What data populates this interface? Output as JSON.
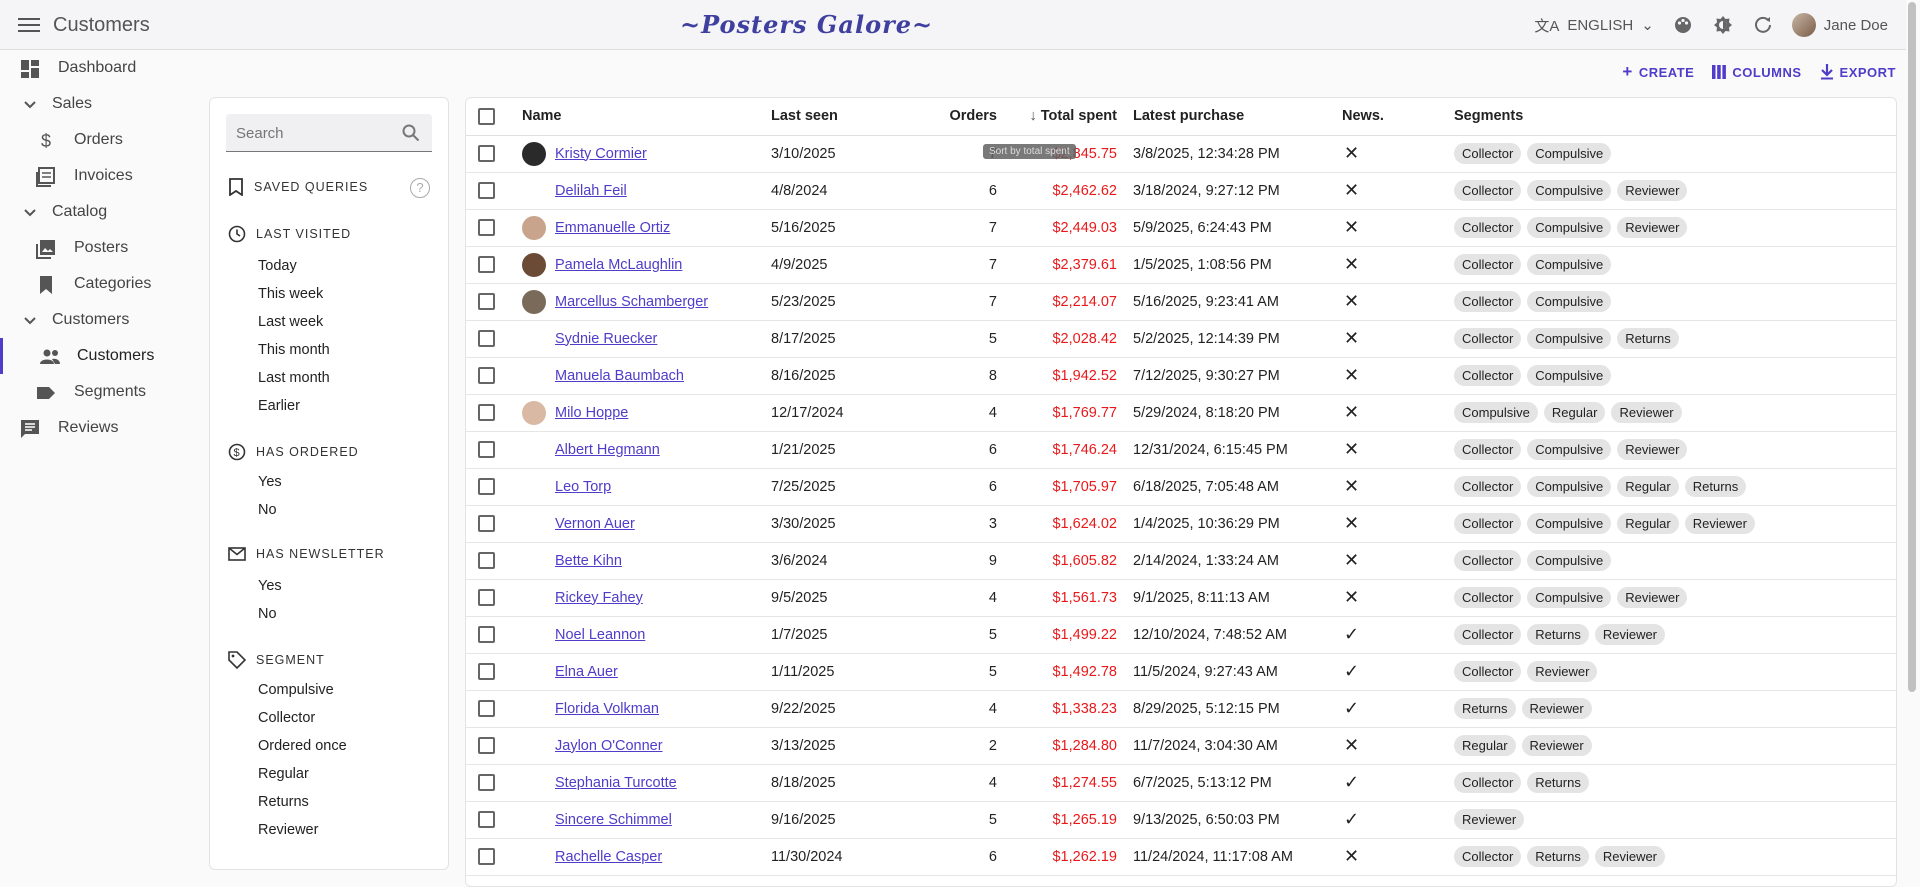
{
  "app": {
    "title": "Customers",
    "brand": "~Posters Galore~",
    "language": "ENGLISH",
    "user": "Jane Doe"
  },
  "sidebar": {
    "items": [
      {
        "label": "Dashboard",
        "icon": "dashboard-icon",
        "kind": "top"
      },
      {
        "label": "Sales",
        "icon": "chevron-down-icon",
        "kind": "group"
      },
      {
        "label": "Orders",
        "icon": "dollar-icon",
        "kind": "sub"
      },
      {
        "label": "Invoices",
        "icon": "invoice-icon",
        "kind": "sub"
      },
      {
        "label": "Catalog",
        "icon": "chevron-down-icon",
        "kind": "group"
      },
      {
        "label": "Posters",
        "icon": "image-icon",
        "kind": "sub"
      },
      {
        "label": "Categories",
        "icon": "bookmark-icon",
        "kind": "sub"
      },
      {
        "label": "Customers",
        "icon": "chevron-down-icon",
        "kind": "group"
      },
      {
        "label": "Customers",
        "icon": "people-icon",
        "kind": "sub",
        "active": true
      },
      {
        "label": "Segments",
        "icon": "label-icon",
        "kind": "sub"
      },
      {
        "label": "Reviews",
        "icon": "comment-icon",
        "kind": "top"
      }
    ]
  },
  "filters": {
    "search_placeholder": "Search",
    "saved_queries": "SAVED QUERIES",
    "last_visited": {
      "title": "LAST VISITED",
      "options": [
        "Today",
        "This week",
        "Last week",
        "This month",
        "Last month",
        "Earlier"
      ]
    },
    "has_ordered": {
      "title": "HAS ORDERED",
      "options": [
        "Yes",
        "No"
      ]
    },
    "has_newsletter": {
      "title": "HAS NEWSLETTER",
      "options": [
        "Yes",
        "No"
      ]
    },
    "segment": {
      "title": "SEGMENT",
      "options": [
        "Compulsive",
        "Collector",
        "Ordered once",
        "Regular",
        "Returns",
        "Reviewer"
      ]
    }
  },
  "toolbar": {
    "create": "CREATE",
    "columns": "COLUMNS",
    "export": "EXPORT"
  },
  "table": {
    "headers": {
      "name": "Name",
      "last_seen": "Last seen",
      "orders": "Orders",
      "total_spent": "Total spent",
      "latest_purchase": "Latest purchase",
      "news": "News.",
      "segments": "Segments"
    },
    "tooltip": "Sort by total spent",
    "rows": [
      {
        "name": "Kristy Cormier",
        "avatar": "#2a2a2a",
        "last_seen": "3/10/2025",
        "orders": "7",
        "total": "$2,845.75",
        "latest": "3/8/2025, 12:34:28 PM",
        "news": "✕",
        "segments": [
          "Collector",
          "Compulsive"
        ]
      },
      {
        "name": "Delilah Feil",
        "avatar": "",
        "last_seen": "4/8/2024",
        "orders": "6",
        "total": "$2,462.62",
        "latest": "3/18/2024, 9:27:12 PM",
        "news": "✕",
        "segments": [
          "Collector",
          "Compulsive",
          "Reviewer"
        ]
      },
      {
        "name": "Emmanuelle Ortiz",
        "avatar": "#c8a48c",
        "last_seen": "5/16/2025",
        "orders": "7",
        "total": "$2,449.03",
        "latest": "5/9/2025, 6:24:43 PM",
        "news": "✕",
        "segments": [
          "Collector",
          "Compulsive",
          "Reviewer"
        ]
      },
      {
        "name": "Pamela McLaughlin",
        "avatar": "#6b4a36",
        "last_seen": "4/9/2025",
        "orders": "7",
        "total": "$2,379.61",
        "latest": "1/5/2025, 1:08:56 PM",
        "news": "✕",
        "segments": [
          "Collector",
          "Compulsive"
        ]
      },
      {
        "name": "Marcellus Schamberger",
        "avatar": "#7a6a5a",
        "last_seen": "5/23/2025",
        "orders": "7",
        "total": "$2,214.07",
        "latest": "5/16/2025, 9:23:41 AM",
        "news": "✕",
        "segments": [
          "Collector",
          "Compulsive"
        ]
      },
      {
        "name": "Sydnie Ruecker",
        "avatar": "",
        "last_seen": "8/17/2025",
        "orders": "5",
        "total": "$2,028.42",
        "latest": "5/2/2025, 12:14:39 PM",
        "news": "✕",
        "segments": [
          "Collector",
          "Compulsive",
          "Returns"
        ]
      },
      {
        "name": "Manuela Baumbach",
        "avatar": "",
        "last_seen": "8/16/2025",
        "orders": "8",
        "total": "$1,942.52",
        "latest": "7/12/2025, 9:30:27 PM",
        "news": "✕",
        "segments": [
          "Collector",
          "Compulsive"
        ]
      },
      {
        "name": "Milo Hoppe",
        "avatar": "#d9b9a3",
        "last_seen": "12/17/2024",
        "orders": "4",
        "total": "$1,769.77",
        "latest": "5/29/2024, 8:18:20 PM",
        "news": "✕",
        "segments": [
          "Compulsive",
          "Regular",
          "Reviewer"
        ]
      },
      {
        "name": "Albert Hegmann",
        "avatar": "",
        "last_seen": "1/21/2025",
        "orders": "6",
        "total": "$1,746.24",
        "latest": "12/31/2024, 6:15:45 PM",
        "news": "✕",
        "segments": [
          "Collector",
          "Compulsive",
          "Reviewer"
        ]
      },
      {
        "name": "Leo Torp",
        "avatar": "",
        "last_seen": "7/25/2025",
        "orders": "6",
        "total": "$1,705.97",
        "latest": "6/18/2025, 7:05:48 AM",
        "news": "✕",
        "segments": [
          "Collector",
          "Compulsive",
          "Regular",
          "Returns"
        ]
      },
      {
        "name": "Vernon Auer",
        "avatar": "",
        "last_seen": "3/30/2025",
        "orders": "3",
        "total": "$1,624.02",
        "latest": "1/4/2025, 10:36:29 PM",
        "news": "✕",
        "segments": [
          "Collector",
          "Compulsive",
          "Regular",
          "Reviewer"
        ]
      },
      {
        "name": "Bette Kihn",
        "avatar": "",
        "last_seen": "3/6/2024",
        "orders": "9",
        "total": "$1,605.82",
        "latest": "2/14/2024, 1:33:24 AM",
        "news": "✕",
        "segments": [
          "Collector",
          "Compulsive"
        ]
      },
      {
        "name": "Rickey Fahey",
        "avatar": "",
        "last_seen": "9/5/2025",
        "orders": "4",
        "total": "$1,561.73",
        "latest": "9/1/2025, 8:11:13 AM",
        "news": "✕",
        "segments": [
          "Collector",
          "Compulsive",
          "Reviewer"
        ]
      },
      {
        "name": "Noel Leannon",
        "avatar": "",
        "last_seen": "1/7/2025",
        "orders": "5",
        "total": "$1,499.22",
        "latest": "12/10/2024, 7:48:52 AM",
        "news": "✓",
        "segments": [
          "Collector",
          "Returns",
          "Reviewer"
        ]
      },
      {
        "name": "Elna Auer",
        "avatar": "",
        "last_seen": "1/11/2025",
        "orders": "5",
        "total": "$1,492.78",
        "latest": "11/5/2024, 9:27:43 AM",
        "news": "✓",
        "segments": [
          "Collector",
          "Reviewer"
        ]
      },
      {
        "name": "Florida Volkman",
        "avatar": "",
        "last_seen": "9/22/2025",
        "orders": "4",
        "total": "$1,338.23",
        "latest": "8/29/2025, 5:12:15 PM",
        "news": "✓",
        "segments": [
          "Returns",
          "Reviewer"
        ]
      },
      {
        "name": "Jaylon O'Conner",
        "avatar": "",
        "last_seen": "3/13/2025",
        "orders": "2",
        "total": "$1,284.80",
        "latest": "11/7/2024, 3:04:30 AM",
        "news": "✕",
        "segments": [
          "Regular",
          "Reviewer"
        ]
      },
      {
        "name": "Stephania Turcotte",
        "avatar": "",
        "last_seen": "8/18/2025",
        "orders": "4",
        "total": "$1,274.55",
        "latest": "6/7/2025, 5:13:12 PM",
        "news": "✓",
        "segments": [
          "Collector",
          "Returns"
        ]
      },
      {
        "name": "Sincere Schimmel",
        "avatar": "",
        "last_seen": "9/16/2025",
        "orders": "5",
        "total": "$1,265.19",
        "latest": "9/13/2025, 6:50:03 PM",
        "news": "✓",
        "segments": [
          "Reviewer"
        ]
      },
      {
        "name": "Rachelle Casper",
        "avatar": "",
        "last_seen": "11/30/2024",
        "orders": "6",
        "total": "$1,262.19",
        "latest": "11/24/2024, 11:17:08 AM",
        "news": "✕",
        "segments": [
          "Collector",
          "Returns",
          "Reviewer"
        ]
      }
    ]
  }
}
